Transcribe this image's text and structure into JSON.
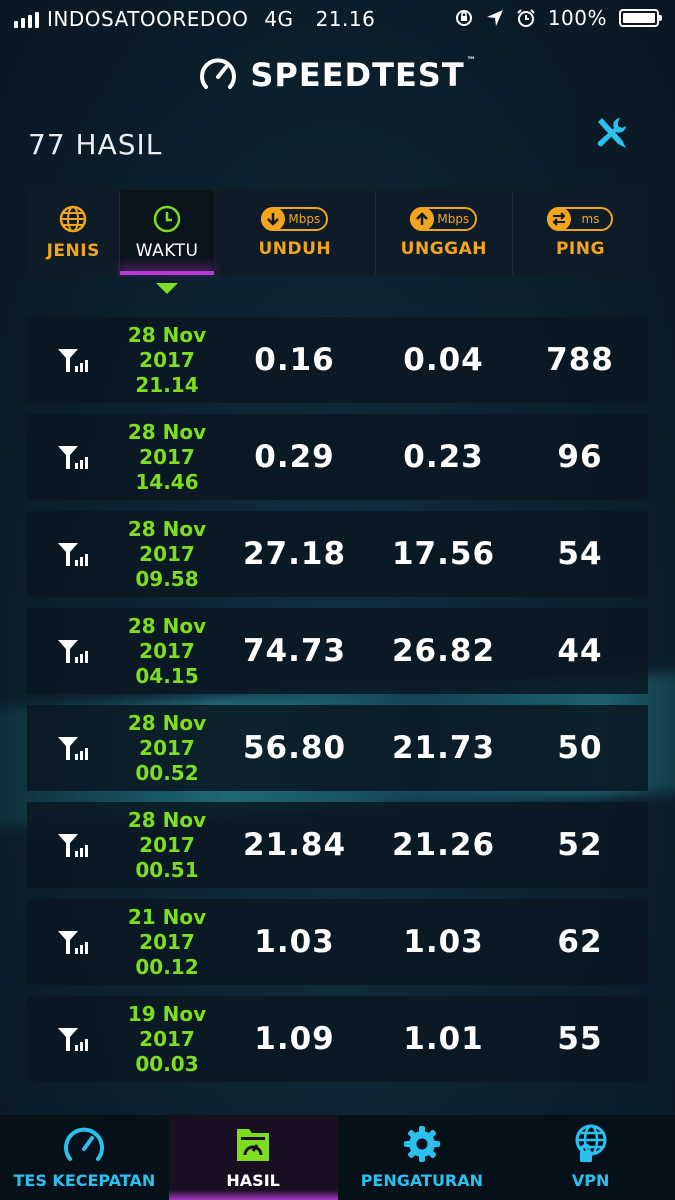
{
  "status_bar": {
    "carrier": "INDOSATOOREDOO",
    "network": "4G",
    "time": "21.16",
    "battery": "100%"
  },
  "app": {
    "title": "SPEEDTEST",
    "tm": "™"
  },
  "results": {
    "count_label": "77 HASIL"
  },
  "columns": {
    "type": "JENIS",
    "time": "WAKTU",
    "download": "UNDUH",
    "upload": "UNGGAH",
    "ping": "PING",
    "speed_unit": "Mbps",
    "ping_unit": "ms"
  },
  "rows": [
    {
      "date": "28 Nov",
      "year": "2017",
      "time": "21.14",
      "download": "0.16",
      "upload": "0.04",
      "ping": "788"
    },
    {
      "date": "28 Nov",
      "year": "2017",
      "time": "14.46",
      "download": "0.29",
      "upload": "0.23",
      "ping": "96"
    },
    {
      "date": "28 Nov",
      "year": "2017",
      "time": "09.58",
      "download": "27.18",
      "upload": "17.56",
      "ping": "54"
    },
    {
      "date": "28 Nov",
      "year": "2017",
      "time": "04.15",
      "download": "74.73",
      "upload": "26.82",
      "ping": "44"
    },
    {
      "date": "28 Nov",
      "year": "2017",
      "time": "00.52",
      "download": "56.80",
      "upload": "21.73",
      "ping": "50"
    },
    {
      "date": "28 Nov",
      "year": "2017",
      "time": "00.51",
      "download": "21.84",
      "upload": "21.26",
      "ping": "52"
    },
    {
      "date": "21 Nov",
      "year": "2017",
      "time": "00.12",
      "download": "1.03",
      "upload": "1.03",
      "ping": "62"
    },
    {
      "date": "19 Nov",
      "year": "2017",
      "time": "00.03",
      "download": "1.09",
      "upload": "1.01",
      "ping": "55"
    }
  ],
  "tabs": [
    {
      "label": "TES KECEPATAN"
    },
    {
      "label": "HASIL"
    },
    {
      "label": "PENGATURAN"
    },
    {
      "label": "VPN"
    }
  ],
  "colors": {
    "accent_orange": "#f2a51c",
    "accent_green": "#7dde20",
    "accent_purple": "#b83bd6",
    "accent_blue": "#2ac1ef"
  }
}
